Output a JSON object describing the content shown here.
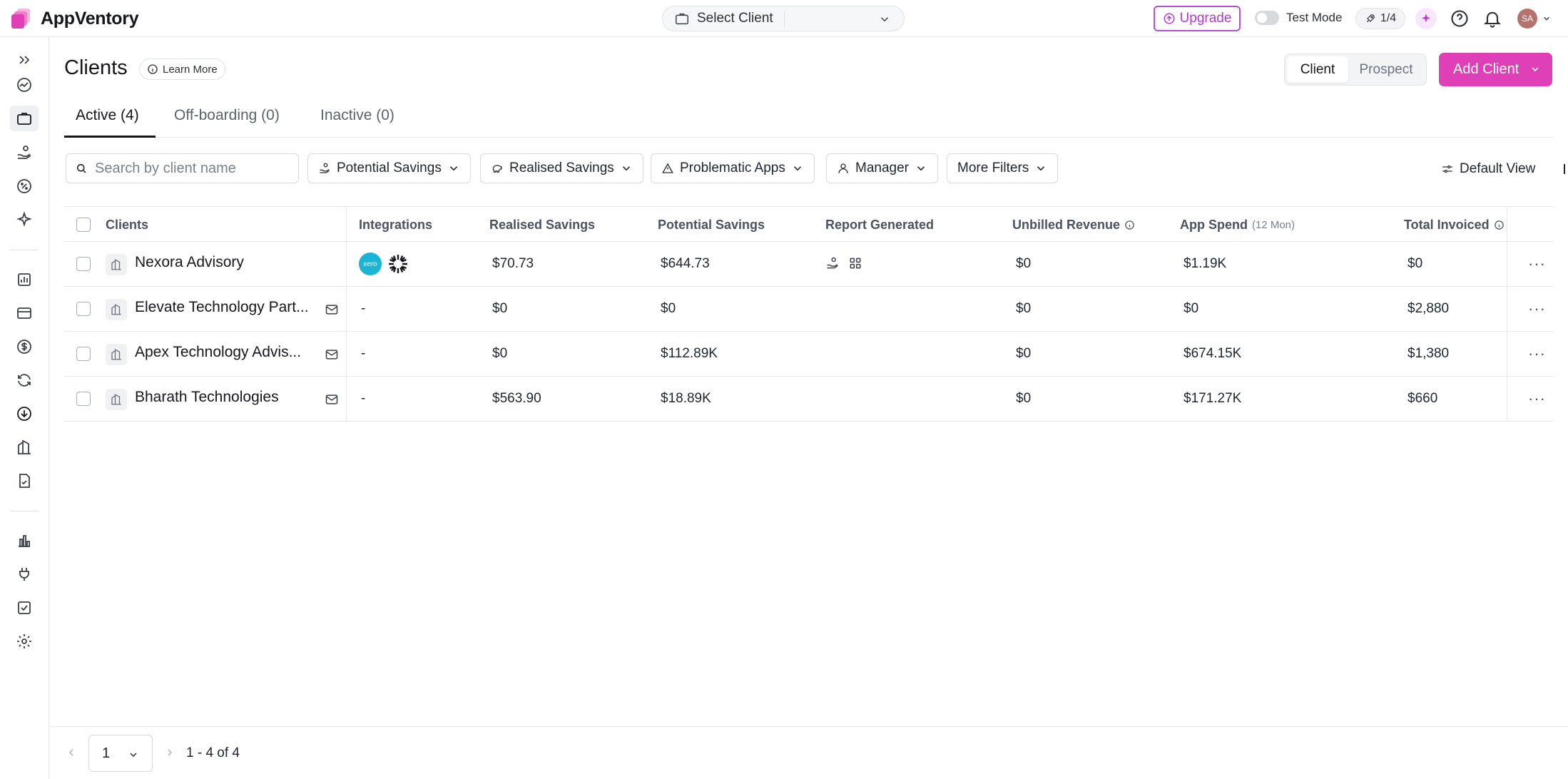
{
  "app": {
    "name": "AppVentory"
  },
  "topbar": {
    "client_select": "Select Client",
    "upgrade": "Upgrade",
    "test_mode": "Test Mode",
    "progress": "1/4",
    "avatar_initials": "SA"
  },
  "page": {
    "title": "Clients",
    "learn_more": "Learn More",
    "segment": [
      "Client",
      "Prospect"
    ],
    "add_client": "Add Client"
  },
  "tabs": [
    "Active (4)",
    "Off-boarding (0)",
    "Inactive (0)"
  ],
  "filters": {
    "search_placeholder": "Search by client name",
    "items": [
      "Potential Savings",
      "Realised Savings",
      "Problematic Apps",
      "Manager",
      "More Filters"
    ],
    "default_view": "Default View"
  },
  "table": {
    "headers": {
      "clients": "Clients",
      "integrations": "Integrations",
      "realised": "Realised Savings",
      "potential": "Potential Savings",
      "report": "Report Generated",
      "unbilled": "Unbilled Revenue",
      "spend": "App Spend",
      "spend_sub": "(12 Mon)",
      "invoiced": "Total Invoiced"
    },
    "rows": [
      {
        "name": "Nexora Advisory",
        "integrations": "",
        "realised": "$70.73",
        "potential": "$644.73",
        "unbilled": "$0",
        "spend": "$1.19K",
        "invoiced": "$0"
      },
      {
        "name": "Elevate Technology Part...",
        "integrations": "-",
        "realised": "$0",
        "potential": "$0",
        "unbilled": "$0",
        "spend": "$0",
        "invoiced": "$2,880"
      },
      {
        "name": "Apex Technology Advis...",
        "integrations": "-",
        "realised": "$0",
        "potential": "$112.89K",
        "unbilled": "$0",
        "spend": "$674.15K",
        "invoiced": "$1,380"
      },
      {
        "name": "Bharath Technologies",
        "integrations": "-",
        "realised": "$563.90",
        "potential": "$18.89K",
        "unbilled": "$0",
        "spend": "$171.27K",
        "invoiced": "$660"
      }
    ],
    "xero_label": "xero",
    "row_menu": "···"
  },
  "pagination": {
    "page": "1",
    "range": "1 - 4 of 4"
  },
  "colors": {
    "accent": "#e040b7",
    "upgrade": "#b23ad3",
    "xero": "#1ab4d7"
  }
}
